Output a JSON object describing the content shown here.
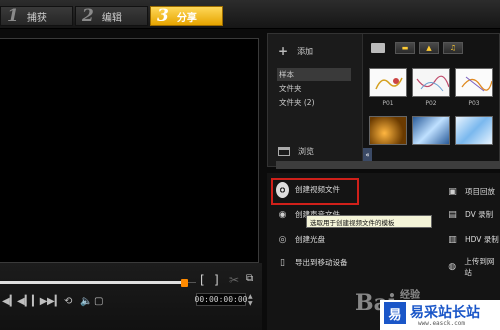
{
  "steps": [
    {
      "num": "1",
      "label": "捕获"
    },
    {
      "num": "2",
      "label": "编辑"
    },
    {
      "num": "3",
      "label": "分享"
    }
  ],
  "library": {
    "add_label": "添加",
    "folders": [
      "样本",
      "文件夹",
      "文件夹 (2)"
    ],
    "browse_label": "浏览",
    "thumb_labels": [
      "P01",
      "P02",
      "P03"
    ],
    "collapse_glyph": "«"
  },
  "preview": {
    "timecode": "00:00:00:00",
    "progress": 1.0,
    "mark_in": "[",
    "mark_out": "]"
  },
  "share": {
    "create_video": "创建视频文件",
    "create_audio": "创建声音文件",
    "create_disc": "创建光盘",
    "export_mobile": "导出到移动设备",
    "project_playback": "项目回放",
    "dv_record": "DV 录制",
    "hdv_record": "HDV 录制",
    "upload_web": "上传到网站",
    "tooltip": "选取用于创建视频文件的模板"
  },
  "watermark": {
    "site": "易采站长站",
    "url": "www.easck.com",
    "baidu": "Bai",
    "jingyan": "经验"
  },
  "colors": {
    "accent": "#f0b400",
    "highlight": "#d0201a",
    "scrub": "#ff8a00"
  }
}
